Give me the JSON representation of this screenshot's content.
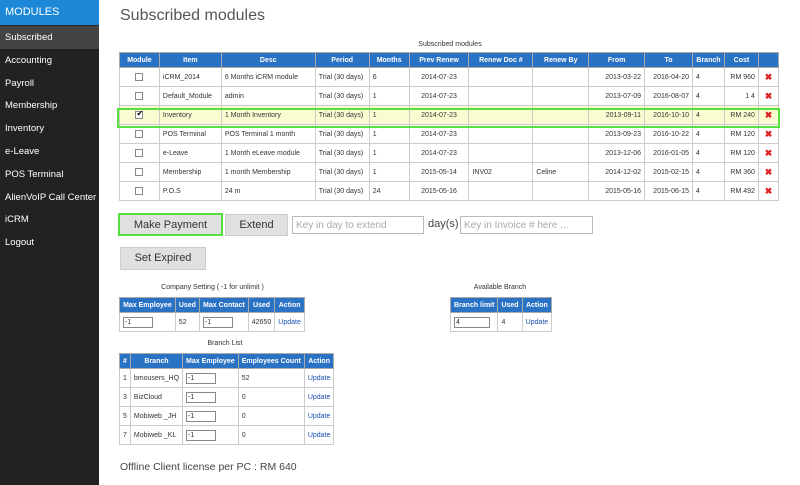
{
  "sidebar": {
    "brand": "MODULES",
    "items": [
      {
        "label": "Subscribed"
      },
      {
        "label": "Accounting"
      },
      {
        "label": "Payroll"
      },
      {
        "label": "Membership"
      },
      {
        "label": "Inventory"
      },
      {
        "label": "e-Leave"
      },
      {
        "label": "POS Terminal"
      },
      {
        "label": "AlienVoIP Call Center Cl"
      },
      {
        "label": "iCRM"
      },
      {
        "label": "Logout"
      }
    ]
  },
  "page": {
    "title": "Subscribed modules"
  },
  "modules": {
    "caption": "Subscribed modules",
    "headers": [
      "Module",
      "Item",
      "Desc",
      "Period",
      "Months",
      "Prev Renew",
      "Renew Doc #",
      "Renew By",
      "From",
      "To",
      "Branch",
      "Cost",
      ""
    ],
    "rows": [
      {
        "item": "iCRM_2014",
        "desc": "6 Months iCRM module",
        "period": "Trial (30 days)",
        "months": "6",
        "prev": "2014-07-23",
        "doc": "",
        "by": "",
        "from": "2013-03-22",
        "to": "2016-04-20",
        "branch": "4",
        "cost": "RM 960",
        "checked": false
      },
      {
        "item": "Default_Module",
        "desc": "admin",
        "period": "Trial (30 days)",
        "months": "1",
        "prev": "2014-07-23",
        "doc": "",
        "by": "",
        "from": "2013-07-09",
        "to": "2016-08-07",
        "branch": "4",
        "cost": "1 4",
        "checked": false
      },
      {
        "item": "Inventory",
        "desc": "1 Month Inventory",
        "period": "Trial (30 days)",
        "months": "1",
        "prev": "2014-07-23",
        "doc": "",
        "by": "",
        "from": "2013-09-11",
        "to": "2016-10-10",
        "branch": "4",
        "cost": "RM 240",
        "checked": true
      },
      {
        "item": "POS Terminal",
        "desc": "POS Terminal 1 month",
        "period": "Trial (30 days)",
        "months": "1",
        "prev": "2014-07-23",
        "doc": "",
        "by": "",
        "from": "2013-09-23",
        "to": "2016-10-22",
        "branch": "4",
        "cost": "RM 120",
        "checked": false
      },
      {
        "item": "e-Leave",
        "desc": "1 Month eLeave module",
        "period": "Trial (30 days)",
        "months": "1",
        "prev": "2014-07-23",
        "doc": "",
        "by": "",
        "from": "2013-12-06",
        "to": "2016-01-05",
        "branch": "4",
        "cost": "RM 120",
        "checked": false
      },
      {
        "item": "Membership",
        "desc": "1 month Membership",
        "period": "Trial (30 days)",
        "months": "1",
        "prev": "2015-05-14",
        "doc": "INV02",
        "by": "Celine",
        "from": "2014-12-02",
        "to": "2015-02-15",
        "branch": "4",
        "cost": "RM 360",
        "checked": false
      },
      {
        "item": "P.O.S",
        "desc": "24 m",
        "period": "Trial (30 days)",
        "months": "24",
        "prev": "2015-05-16",
        "doc": "",
        "by": "",
        "from": "2015-05-16",
        "to": "2015-06-15",
        "branch": "4",
        "cost": "RM 492",
        "checked": false
      }
    ]
  },
  "actions": {
    "make_payment": "Make Payment",
    "extend": "Extend",
    "days_placeholder": "Key in day to extend",
    "days_suffix": "day(s)",
    "invoice_placeholder": "Key in Invoice # here ...",
    "set_expired": "Set Expired"
  },
  "company_setting": {
    "caption": "Company Setting ( -1 for unlimit )",
    "headers": [
      "Max Employee",
      "Used",
      "Max Contact",
      "Used",
      "Action"
    ],
    "max_employee": "-1",
    "used_employee": "52",
    "max_contact": "-1",
    "used_contact": "42650",
    "action": "Update"
  },
  "available_branch": {
    "caption": "Available Branch",
    "headers": [
      "Branch limit",
      "Used",
      "Action"
    ],
    "limit": "4",
    "used": "4",
    "action": "Update"
  },
  "branch_list": {
    "caption": "Branch List",
    "headers": [
      "#",
      "Branch",
      "Max Employee",
      "Employees Count",
      "Action"
    ],
    "rows": [
      {
        "num": "1",
        "branch": "bmousers_HQ",
        "max": "-1",
        "count": "52",
        "action": "Update"
      },
      {
        "num": "3",
        "branch": "BizCloud",
        "max": "-1",
        "count": "0",
        "action": "Update"
      },
      {
        "num": "5",
        "branch": "Mobiweb _JH",
        "max": "-1",
        "count": "0",
        "action": "Update"
      },
      {
        "num": "7",
        "branch": "Mobiweb _KL",
        "max": "-1",
        "count": "0",
        "action": "Update"
      }
    ]
  },
  "footer": {
    "license_text": "Offline Client license per PC : RM 640"
  }
}
